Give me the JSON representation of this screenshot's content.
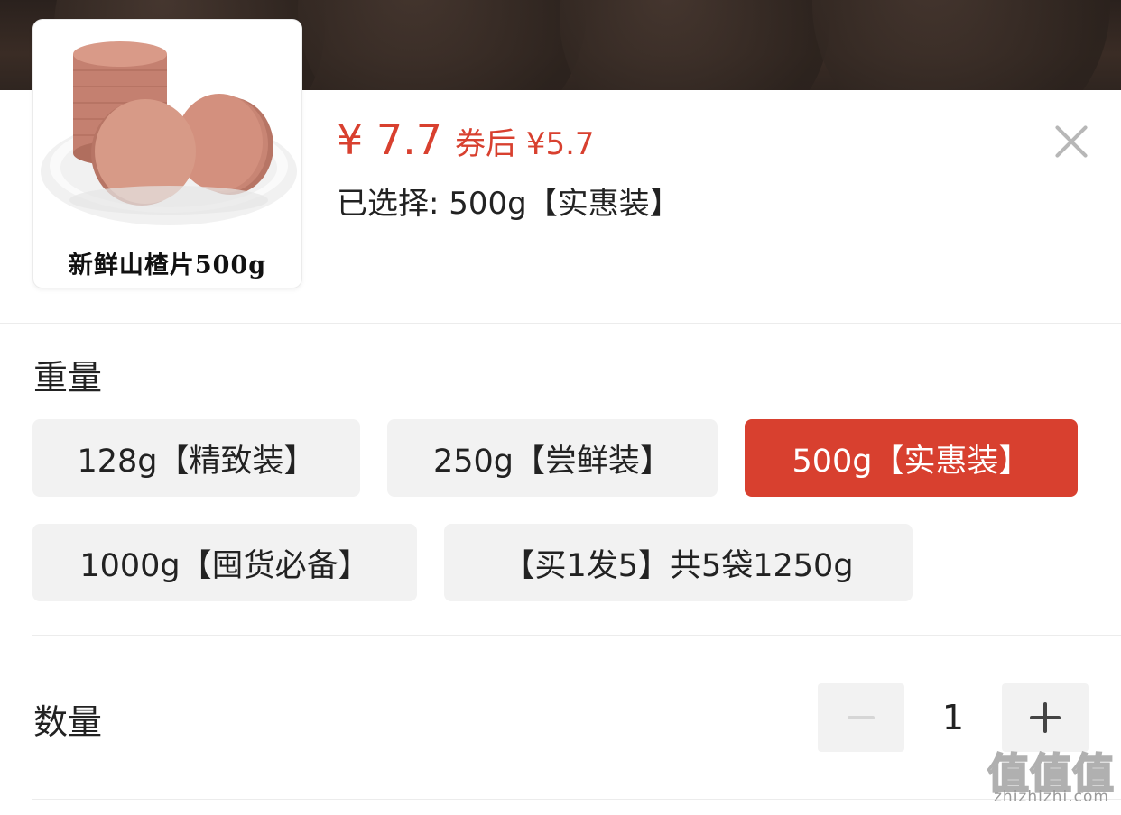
{
  "product": {
    "thumbnail_caption": "新鲜山楂片500g",
    "price": "¥ 7.7",
    "coupon_price": "券后 ¥5.7",
    "selected_text": "已选择: 500g【实惠装】"
  },
  "weight": {
    "title": "重量",
    "options": [
      {
        "label": "128g【精致装】",
        "selected": false
      },
      {
        "label": "250g【尝鲜装】",
        "selected": false
      },
      {
        "label": "500g【实惠装】",
        "selected": true
      },
      {
        "label": "1000g【囤货必备】",
        "selected": false
      },
      {
        "label": "【买1发5】共5袋1250g",
        "selected": false
      }
    ]
  },
  "quantity": {
    "title": "数量",
    "value": "1",
    "decrement_disabled": true
  },
  "watermark": {
    "glyphs": [
      "值",
      "值",
      "值"
    ],
    "text": "zhizhizhi.com"
  },
  "colors": {
    "accent": "#d8402f",
    "option_bg": "#f2f2f2",
    "divider": "#ececec"
  },
  "icons": {
    "close": "close-icon",
    "minus": "minus-icon",
    "plus": "plus-icon"
  }
}
